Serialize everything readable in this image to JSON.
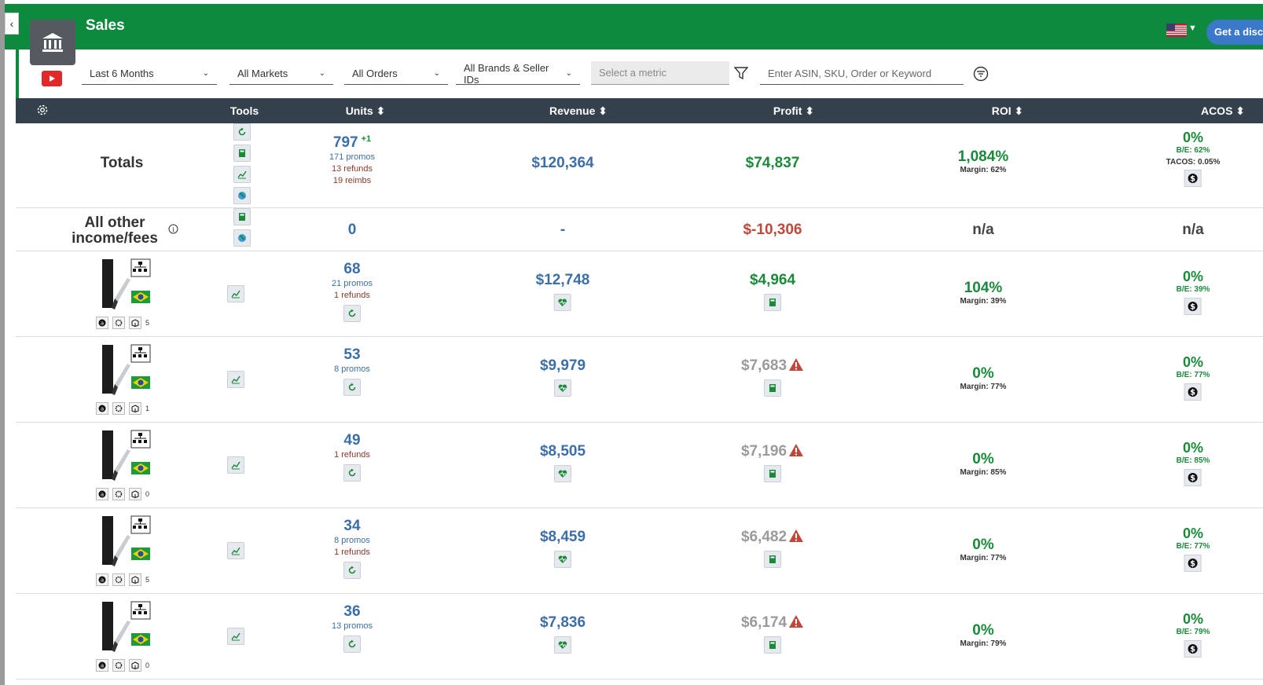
{
  "header": {
    "title": "Sales",
    "discount_label": "Get a discou"
  },
  "filters": {
    "period": "Last 6 Months",
    "markets": "All Markets",
    "orders": "All Orders",
    "brands": "All Brands & Seller IDs",
    "metric_placeholder": "Select a metric",
    "search_placeholder": "Enter ASIN, SKU, Order or Keyword"
  },
  "columns": {
    "tools": "Tools",
    "units": "Units",
    "revenue": "Revenue",
    "profit": "Profit",
    "roi": "ROI",
    "acos": "ACOS"
  },
  "totals": {
    "label": "Totals",
    "units": "797",
    "units_delta": "+1",
    "promos": "171 promos",
    "refunds": "13 refunds",
    "reimbs": "19 reimbs",
    "revenue": "$120,364",
    "profit": "$74,837",
    "roi": "1,084%",
    "margin": "Margin: 62%",
    "acos": "0%",
    "be": "B/E: 62%",
    "tacos": "TACOS: 0.05%"
  },
  "other": {
    "label_line1": "All other",
    "label_line2": "income/fees",
    "units": "0",
    "revenue": "-",
    "profit": "$-10,306",
    "roi": "n/a",
    "acos": "n/a"
  },
  "products": [
    {
      "units": "68",
      "promos": "21 promos",
      "refunds": "1 refunds",
      "revenue": "$12,748",
      "profit": "$4,964",
      "profit_warn": false,
      "roi": "104%",
      "margin": "Margin: 39%",
      "acos": "0%",
      "be": "B/E: 39%",
      "count": "5"
    },
    {
      "units": "53",
      "promos": "8 promos",
      "refunds": "",
      "revenue": "$9,979",
      "profit": "$7,683",
      "profit_warn": true,
      "roi": "0%",
      "margin": "Margin: 77%",
      "acos": "0%",
      "be": "B/E: 77%",
      "count": "1"
    },
    {
      "units": "49",
      "promos": "",
      "refunds": "1 refunds",
      "revenue": "$8,505",
      "profit": "$7,196",
      "profit_warn": true,
      "roi": "0%",
      "margin": "Margin: 85%",
      "acos": "0%",
      "be": "B/E: 85%",
      "count": "0"
    },
    {
      "units": "34",
      "promos": "8 promos",
      "refunds": "1 refunds",
      "revenue": "$8,459",
      "profit": "$6,482",
      "profit_warn": true,
      "roi": "0%",
      "margin": "Margin: 77%",
      "acos": "0%",
      "be": "B/E: 77%",
      "count": "5"
    },
    {
      "units": "36",
      "promos": "13 promos",
      "refunds": "",
      "revenue": "$7,836",
      "profit": "$6,174",
      "profit_warn": true,
      "roi": "0%",
      "margin": "Margin: 79%",
      "acos": "0%",
      "be": "B/E: 79%",
      "count": "0"
    }
  ],
  "icons": {
    "back": "chevron-left-icon",
    "bank": "bank-icon",
    "youtube": "youtube-icon",
    "flag": "us-flag-icon",
    "funnel": "funnel-icon",
    "filter": "filter-circle-icon",
    "gear": "gear-icon",
    "refresh": "refresh-icon",
    "calculator": "calculator-icon",
    "chart": "line-chart-icon",
    "globe": "globe-icon",
    "heart": "heart-pulse-icon",
    "dollar": "dollar-icon",
    "warning": "warning-icon",
    "hierarchy": "hierarchy-icon",
    "brazil": "brazil-flag-icon"
  },
  "colors": {
    "topbar": "#0e8a3e",
    "header": "#34404c",
    "positive": "#1a8a3a",
    "negative": "#c0483a",
    "link": "#3c6ea8"
  }
}
